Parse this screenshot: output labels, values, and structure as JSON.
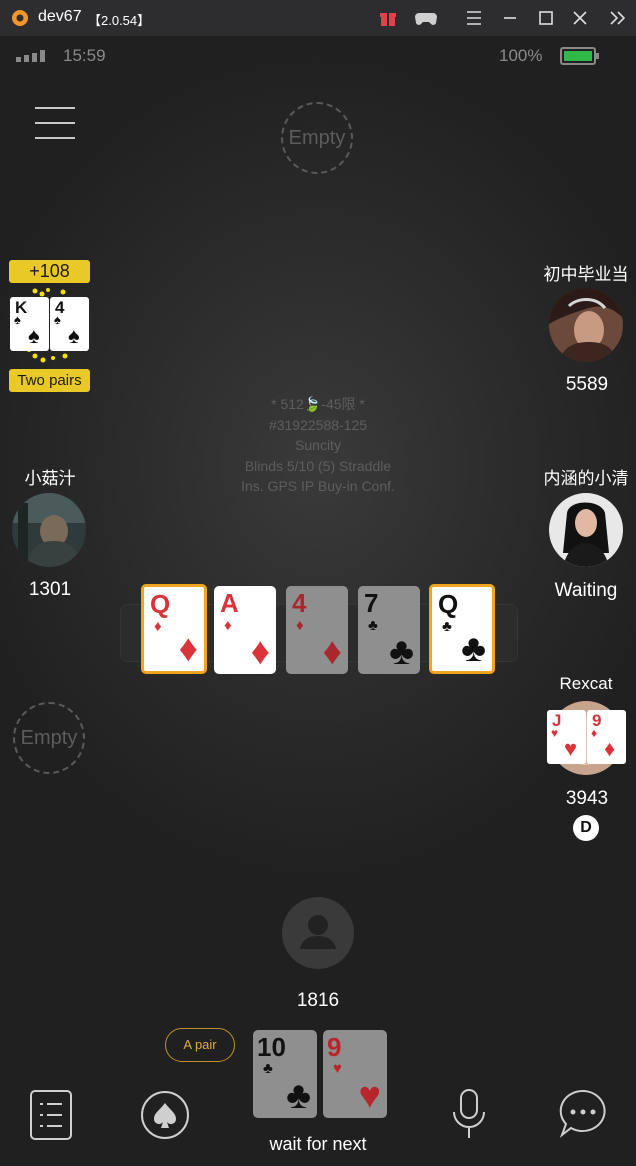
{
  "window": {
    "app_name": "dev67",
    "version": "【2.0.54】"
  },
  "status": {
    "time": "15:59",
    "battery": "100%"
  },
  "seats": {
    "top_empty": "Empty",
    "left_empty": "Empty",
    "winner": {
      "gain": "+108",
      "hand": "Two pairs",
      "cards": [
        {
          "rank": "K",
          "suit": "♠"
        },
        {
          "rank": "4",
          "suit": "♠"
        }
      ]
    },
    "xiaoguzhi": {
      "name": "小菇汁",
      "chips": "1301"
    },
    "chuzhong": {
      "name": "初中毕业当",
      "chips": "5589"
    },
    "neihan": {
      "name": "内涵的小清",
      "status": "Waiting"
    },
    "rexcat": {
      "name": "Rexcat",
      "chips": "3943",
      "cards": [
        {
          "rank": "J",
          "suit": "♥"
        },
        {
          "rank": "9",
          "suit": "♦"
        }
      ],
      "dealer": "D"
    }
  },
  "table_info": {
    "line1": "* 512",
    "line1_tail": "-45限 *",
    "line2": "#31922588-125",
    "line3": "Suncity",
    "line4": "Blinds 5/10 (5) Straddle",
    "line5": "Ins. GPS IP Buy-in Conf."
  },
  "board": [
    {
      "rank": "Q",
      "suit": "♦",
      "color": "red",
      "highlight": true,
      "dim": false
    },
    {
      "rank": "A",
      "suit": "♦",
      "color": "red",
      "highlight": false,
      "dim": false
    },
    {
      "rank": "4",
      "suit": "♦",
      "color": "red",
      "highlight": false,
      "dim": true
    },
    {
      "rank": "7",
      "suit": "♣",
      "color": "black",
      "highlight": false,
      "dim": true
    },
    {
      "rank": "Q",
      "suit": "♣",
      "color": "black",
      "highlight": true,
      "dim": false
    }
  ],
  "me": {
    "chips": "1816",
    "hand_label": "A pair",
    "cards": [
      {
        "rank": "10",
        "suit": "♣",
        "color": "black"
      },
      {
        "rank": "9",
        "suit": "♥",
        "color": "red"
      }
    ],
    "status": "wait for next"
  },
  "colors": {
    "highlight": "#f0a51c",
    "badge": "#e8c928",
    "red_suit": "#d8343a"
  },
  "icons": [
    "menu-icon",
    "list-icon",
    "spade-icon",
    "microphone-icon",
    "chat-icon",
    "gift-icon",
    "gamepad-icon"
  ]
}
